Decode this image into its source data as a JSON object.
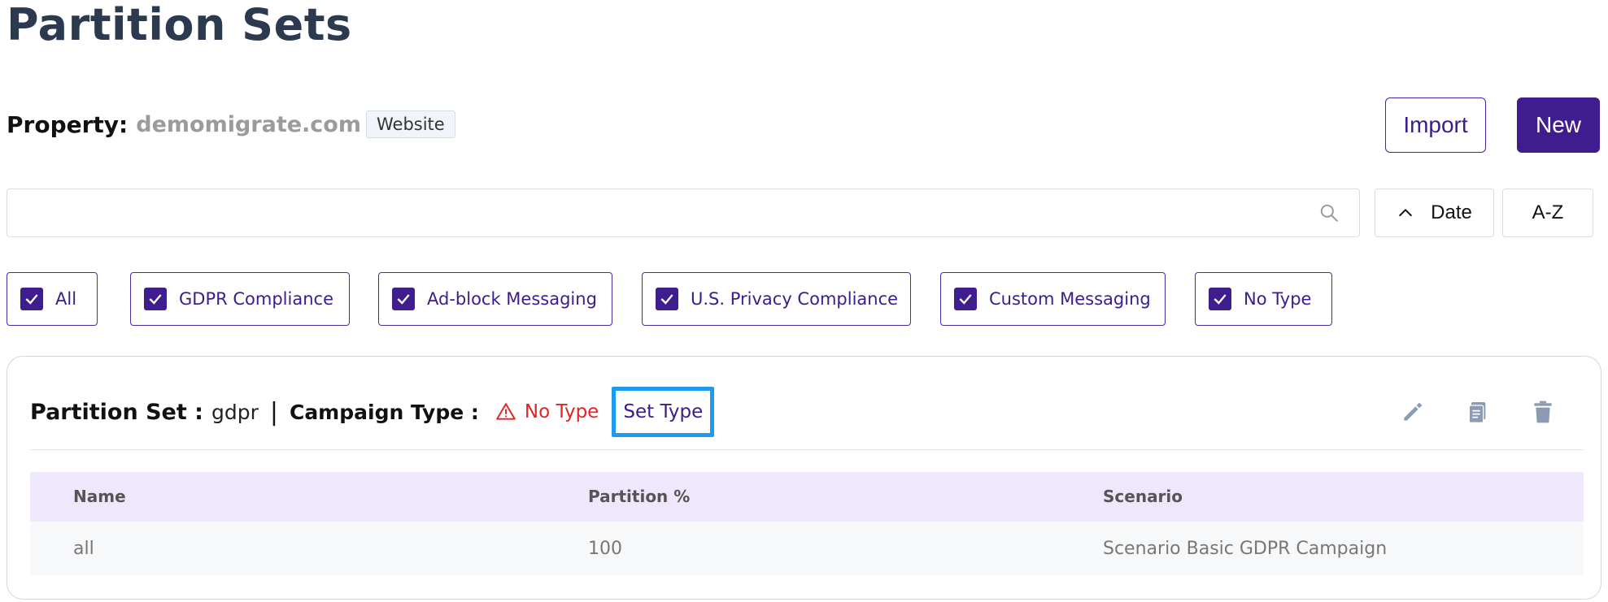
{
  "page": {
    "title": "Partition Sets"
  },
  "property": {
    "label": "Property:",
    "value": "demomigrate.com",
    "badge": "Website"
  },
  "actions": {
    "import_label": "Import",
    "new_label": "New"
  },
  "search": {
    "value": "",
    "placeholder": "",
    "icon": "search-icon"
  },
  "sort": {
    "date_label": "Date",
    "date_direction": "ascending",
    "az_label": "A-Z"
  },
  "filters": [
    {
      "label": "All",
      "checked": true
    },
    {
      "label": "GDPR Compliance",
      "checked": true
    },
    {
      "label": "Ad-block Messaging",
      "checked": true
    },
    {
      "label": "U.S. Privacy Compliance",
      "checked": true
    },
    {
      "label": "Custom Messaging",
      "checked": true
    },
    {
      "label": "No Type",
      "checked": true
    }
  ],
  "card": {
    "partition_set_label": "Partition Set :",
    "partition_set_value": "gdpr",
    "separator": "|",
    "campaign_type_label": "Campaign Type :",
    "campaign_type_value": "No Type",
    "set_type_label": "Set Type",
    "table": {
      "columns": [
        "Name",
        "Partition %",
        "Scenario"
      ],
      "rows": [
        [
          "all",
          "100",
          "Scenario Basic GDPR Campaign"
        ]
      ]
    }
  },
  "colors": {
    "primary": "#3f1d8f",
    "warning": "#e02424",
    "focus_outline": "#1e9bf0",
    "table_header_bg": "#efe8fd",
    "icon_gray": "#8a9bb3"
  }
}
